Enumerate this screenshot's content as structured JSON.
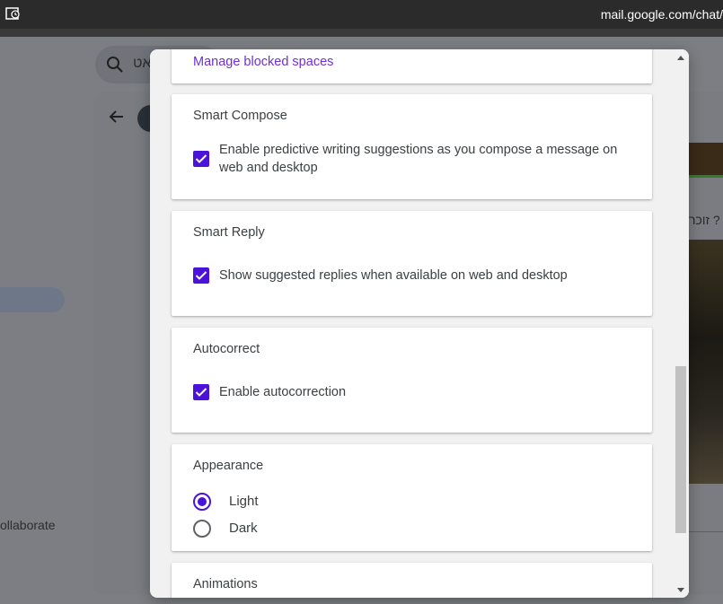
{
  "browser": {
    "url": "mail.google.com/chat/"
  },
  "background": {
    "search_text": "צ'אט",
    "collab_text": "ollaborate",
    "hebrew_snippet": "? זוכר"
  },
  "dialog": {
    "blocked_link": "Manage blocked spaces",
    "smart_compose": {
      "title": "Smart Compose",
      "checkbox_label": "Enable predictive writing suggestions as you compose a message on web and desktop",
      "checked": true
    },
    "smart_reply": {
      "title": "Smart Reply",
      "checkbox_label": "Show suggested replies when available on web and desktop",
      "checked": true
    },
    "autocorrect": {
      "title": "Autocorrect",
      "checkbox_label": "Enable autocorrection",
      "checked": true
    },
    "appearance": {
      "title": "Appearance",
      "options": [
        "Light",
        "Dark"
      ],
      "selected": "Light"
    },
    "animations": {
      "title": "Animations"
    }
  },
  "colors": {
    "accent": "#4b12d9",
    "link": "#6f2fd6"
  }
}
